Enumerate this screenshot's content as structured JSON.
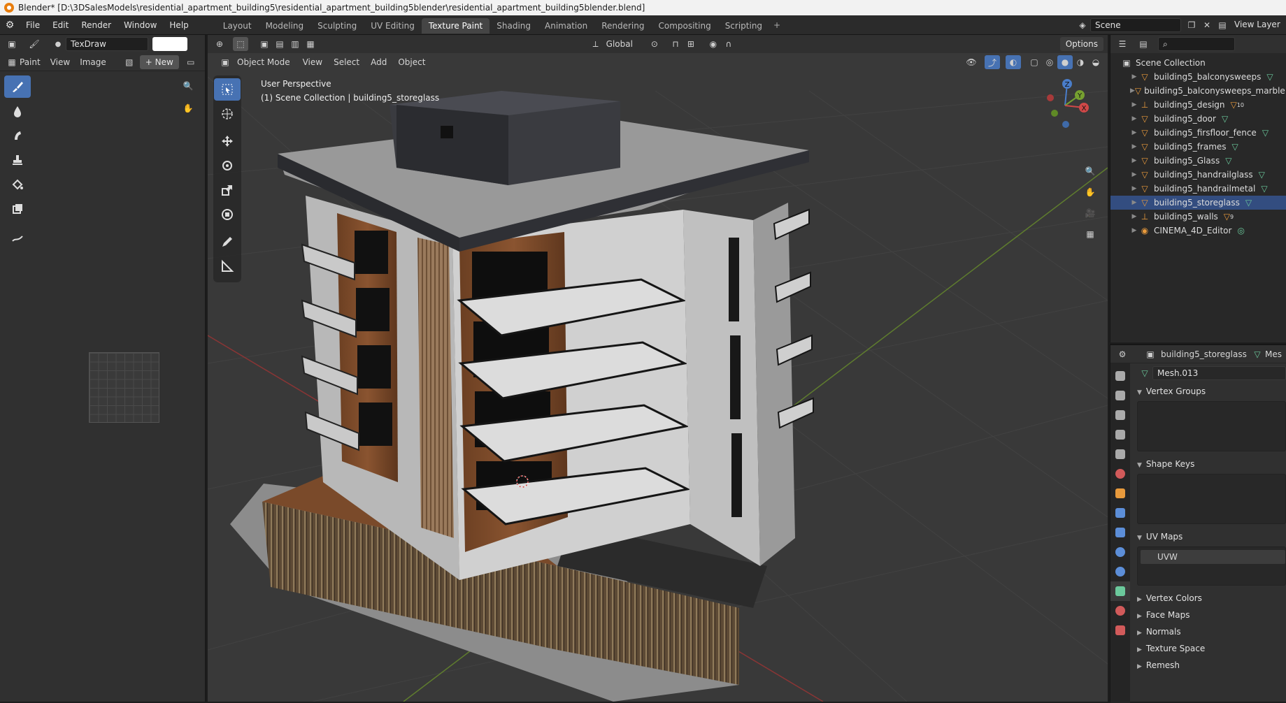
{
  "window": {
    "title": "Blender* [D:\\3DSalesModels\\residential_apartment_building5\\residential_apartment_building5blender\\residential_apartment_building5blender.blend]"
  },
  "menu": [
    "File",
    "Edit",
    "Render",
    "Window",
    "Help"
  ],
  "workspaces": [
    "Layout",
    "Modeling",
    "Sculpting",
    "UV Editing",
    "Texture Paint",
    "Shading",
    "Animation",
    "Rendering",
    "Compositing",
    "Scripting"
  ],
  "active_workspace": "Texture Paint",
  "scene": {
    "name": "Scene",
    "view_layer": "View Layer"
  },
  "image_editor": {
    "brush_name": "TexDraw",
    "mode": "Paint",
    "menus": [
      "View",
      "Image"
    ],
    "new_label": "New"
  },
  "viewport": {
    "mode": "Object Mode",
    "menus": [
      "View",
      "Select",
      "Add",
      "Object"
    ],
    "orientation": "Global",
    "options_label": "Options",
    "info_line1": "User Perspective",
    "info_line2": "(1) Scene Collection | building5_storeglass",
    "gizmo": {
      "z": "Z",
      "y": "Y",
      "x": "X"
    }
  },
  "outliner": {
    "root": "Scene Collection",
    "items": [
      {
        "name": "building5_balconysweeps",
        "kind": "mesh",
        "badge": ""
      },
      {
        "name": "building5_balconysweeps_marble",
        "kind": "mesh",
        "badge": ""
      },
      {
        "name": "building5_design",
        "kind": "empty",
        "badge": "10"
      },
      {
        "name": "building5_door",
        "kind": "mesh",
        "badge": ""
      },
      {
        "name": "building5_firsfloor_fence",
        "kind": "mesh",
        "badge": ""
      },
      {
        "name": "building5_frames",
        "kind": "mesh",
        "badge": ""
      },
      {
        "name": "building5_Glass",
        "kind": "mesh",
        "badge": ""
      },
      {
        "name": "building5_handrailglass",
        "kind": "mesh",
        "badge": ""
      },
      {
        "name": "building5_handrailmetal",
        "kind": "mesh",
        "badge": ""
      },
      {
        "name": "building5_storeglass",
        "kind": "mesh",
        "badge": "",
        "selected": true
      },
      {
        "name": "building5_walls",
        "kind": "empty",
        "badge": "9"
      },
      {
        "name": "CINEMA_4D_Editor",
        "kind": "camera",
        "badge": ""
      }
    ]
  },
  "properties": {
    "object_name": "building5_storeglass",
    "header_extra": "Mes",
    "mesh_name": "Mesh.013",
    "sections": {
      "vertex_groups": "Vertex Groups",
      "shape_keys": "Shape Keys",
      "uv_maps": "UV Maps",
      "vertex_colors": "Vertex Colors",
      "face_maps": "Face Maps",
      "normals": "Normals",
      "texture_space": "Texture Space",
      "remesh": "Remesh"
    },
    "uv_map_item": "UVW"
  },
  "colors": {
    "accent": "#4772b3",
    "mesh_icon": "#e89a3c",
    "data_icon": "#6bc99c"
  }
}
